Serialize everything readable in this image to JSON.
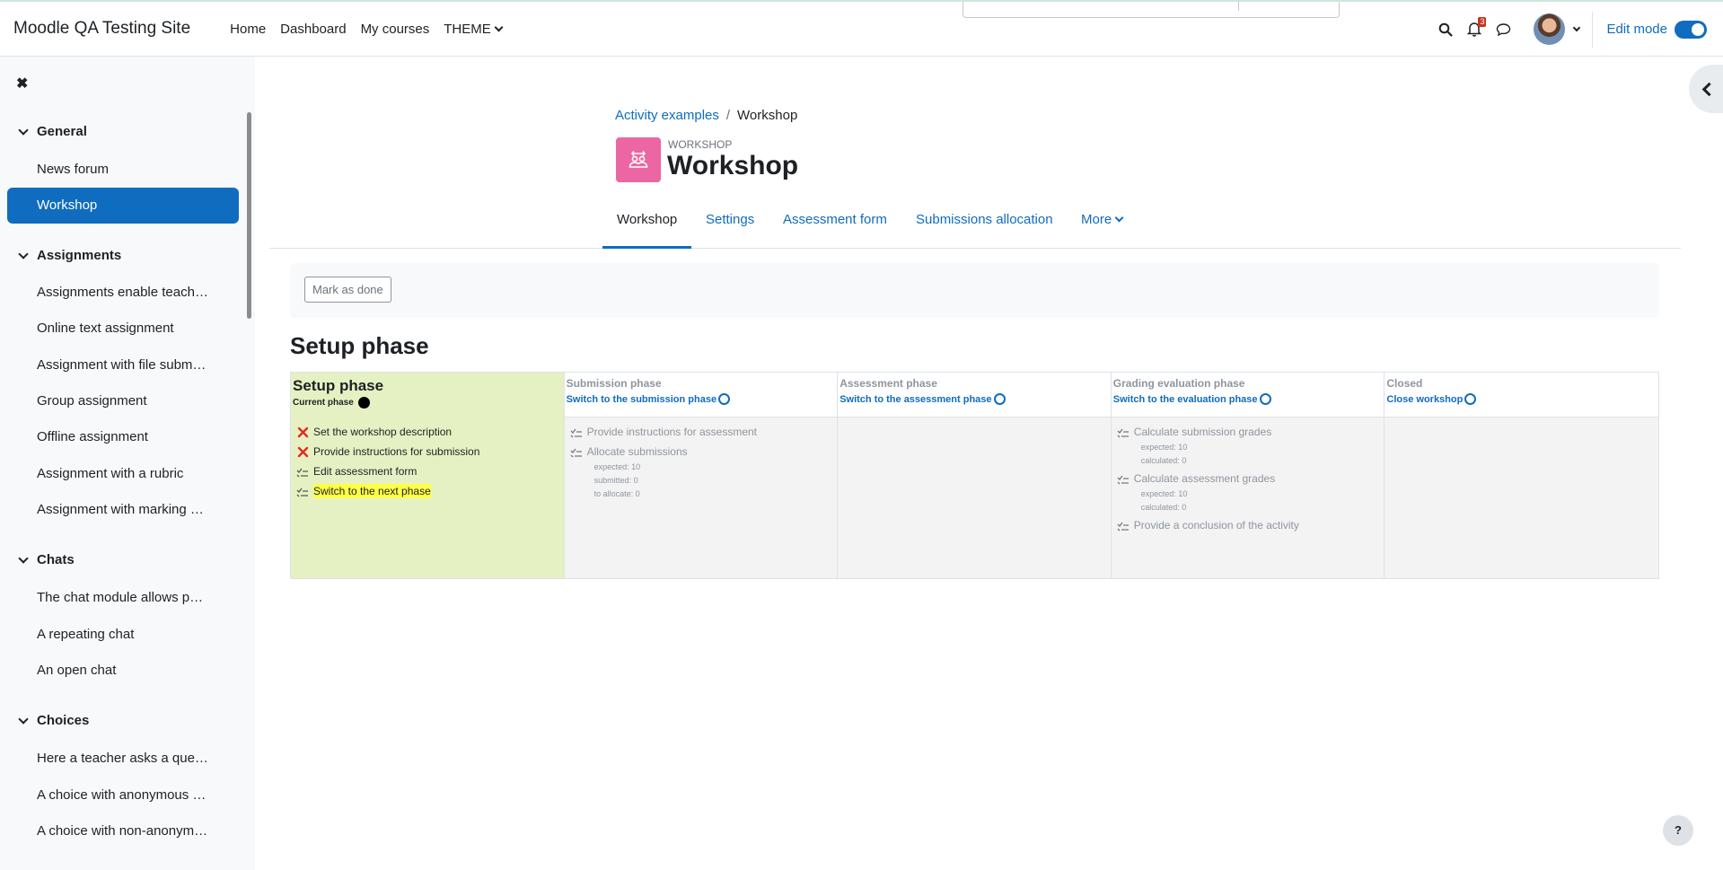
{
  "navbar": {
    "site_name": "Moodle QA Testing Site",
    "links": [
      "Home",
      "Dashboard",
      "My courses",
      "THEME"
    ],
    "notification_count": "3",
    "edit_mode_label": "Edit mode"
  },
  "drawer": {
    "sections": [
      {
        "title": "General",
        "items": [
          "News forum",
          "Workshop"
        ]
      },
      {
        "title": "Assignments",
        "items": [
          "Assignments enable teach…",
          "Online text assignment",
          "Assignment with file subm…",
          "Group assignment",
          "Offline assignment",
          "Assignment with a rubric",
          "Assignment with marking …"
        ]
      },
      {
        "title": "Chats",
        "items": [
          "The chat module allows p…",
          "A repeating chat",
          "An open chat"
        ]
      },
      {
        "title": "Choices",
        "items": [
          "Here a teacher asks a que…",
          "A choice with anonymous …",
          "A choice with non-anonym…"
        ]
      }
    ]
  },
  "breadcrumb": {
    "parent": "Activity examples",
    "separator": "/",
    "current": "Workshop"
  },
  "header": {
    "pretitle": "WORKSHOP",
    "title": "Workshop"
  },
  "tabs": [
    "Workshop",
    "Settings",
    "Assessment form",
    "Submissions allocation",
    "More"
  ],
  "completion": {
    "mark_done_label": "Mark as done"
  },
  "phase_heading": "Setup phase",
  "planner": {
    "setup": {
      "name": "Setup phase",
      "current_label": "Current phase",
      "tasks": [
        {
          "text": "Set the workshop description",
          "status": "fail"
        },
        {
          "text": "Provide instructions for submission",
          "status": "fail"
        },
        {
          "text": "Edit assessment form",
          "status": "todo"
        },
        {
          "text": "Switch to the next phase",
          "status": "todo"
        }
      ]
    },
    "submission": {
      "name": "Submission phase",
      "action": "Switch to the submission phase",
      "tasks": [
        {
          "text": "Provide instructions for assessment",
          "details": []
        },
        {
          "text": "Allocate submissions",
          "details": [
            "expected: 10",
            "submitted: 0",
            "to allocate: 0"
          ]
        }
      ]
    },
    "assessment": {
      "name": "Assessment phase",
      "action": "Switch to the assessment phase"
    },
    "evaluation": {
      "name": "Grading evaluation phase",
      "action": "Switch to the evaluation phase",
      "tasks": [
        {
          "text": "Calculate submission grades",
          "details": [
            "expected: 10",
            "calculated: 0"
          ]
        },
        {
          "text": "Calculate assessment grades",
          "details": [
            "expected: 10",
            "calculated: 0"
          ]
        },
        {
          "text": "Provide a conclusion of the activity",
          "details": []
        }
      ]
    },
    "closed": {
      "name": "Closed",
      "action": "Close workshop"
    }
  },
  "help_label": "?",
  "colors": {
    "brand": "#0f6cbf",
    "current_phase_bg": "#e6f1c3",
    "activity_icon_bg": "#eb66a2",
    "highlight": "#ffff47"
  }
}
